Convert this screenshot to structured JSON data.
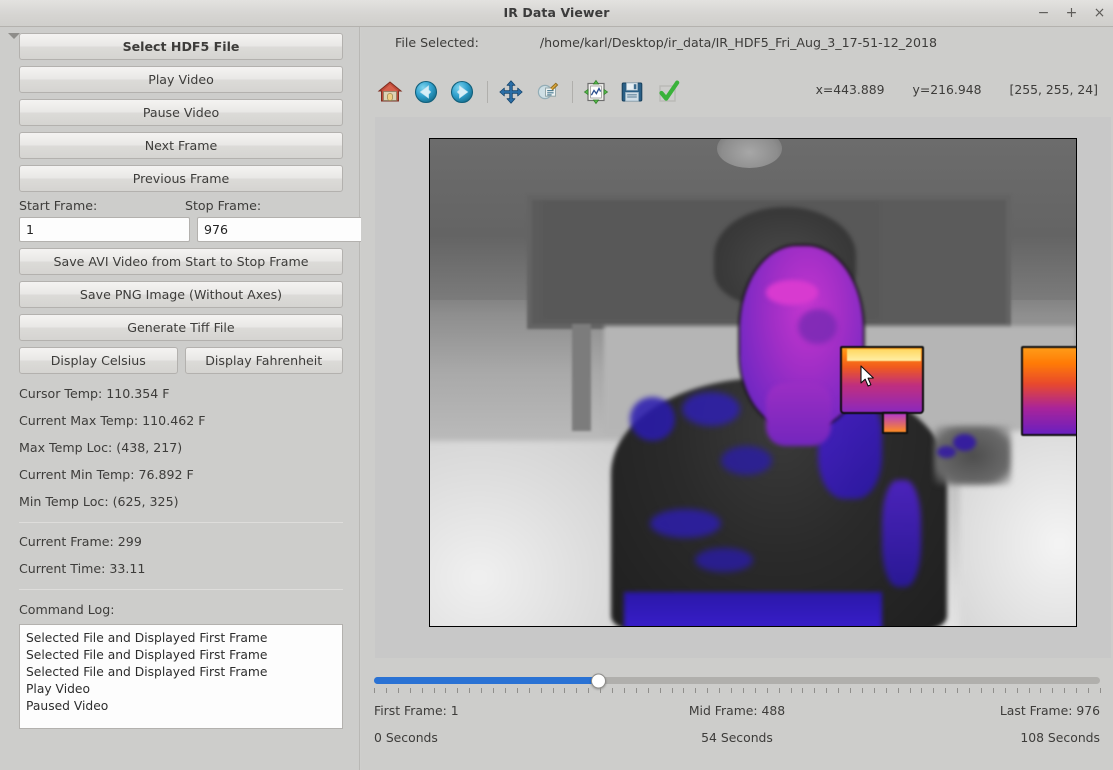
{
  "window": {
    "title": "IR Data Viewer",
    "minimize": "−",
    "maximize": "+",
    "close": "×"
  },
  "sidebar": {
    "buttons": [
      {
        "label": "Select HDF5 File",
        "bold": true
      },
      {
        "label": "Play Video",
        "bold": false
      },
      {
        "label": "Pause Video",
        "bold": false
      },
      {
        "label": "Next Frame",
        "bold": false
      },
      {
        "label": "Previous Frame",
        "bold": false
      }
    ],
    "start_frame_label": "Start Frame:",
    "stop_frame_label": "Stop Frame:",
    "start_frame_value": "1",
    "stop_frame_value": "976",
    "save_avi_label": "Save AVI Video from Start to Stop Frame",
    "save_png_label": "Save PNG Image (Without Axes)",
    "generate_tiff_label": "Generate Tiff File",
    "display_celsius_label": "Display Celsius",
    "display_fahrenheit_label": "Display Fahrenheit",
    "stats": [
      "Cursor Temp: 110.354 F",
      "Current Max Temp: 110.462 F",
      "Max Temp Loc: (438, 217)",
      "Current Min Temp: 76.892 F",
      "Min Temp Loc: (625, 325)"
    ],
    "frame_stats": [
      "Current Frame: 299",
      "Current Time: 33.11"
    ],
    "command_log_label": "Command Log:",
    "command_log": [
      "Selected File and Displayed First Frame",
      "Selected File and Displayed First Frame",
      "Selected File and Displayed First Frame",
      "Play Video",
      "Paused Video"
    ]
  },
  "main": {
    "file_selected_label": "File Selected:",
    "file_path": "/home/karl/Desktop/ir_data/IR_HDF5_Fri_Aug_3_17-51-12_2018",
    "toolbar": [
      {
        "name": "home-icon",
        "tip": "Home"
      },
      {
        "name": "back-arrow-icon",
        "tip": "Back"
      },
      {
        "name": "forward-arrow-icon",
        "tip": "Forward"
      },
      {
        "name": "pan-move-icon",
        "tip": "Pan"
      },
      {
        "name": "zoom-rect-icon",
        "tip": "Zoom to rectangle"
      },
      {
        "name": "configure-subplots-icon",
        "tip": "Configure subplots"
      },
      {
        "name": "save-floppy-icon",
        "tip": "Save figure"
      },
      {
        "name": "green-check-icon",
        "tip": "Apply"
      }
    ],
    "readout": {
      "x": "x=443.889",
      "y": "y=216.948",
      "rgb": "[255, 255, 24]"
    }
  },
  "chart_data": {
    "type": "heatmap",
    "title": "",
    "xlabel": "",
    "ylabel": "",
    "xticks": [
      0,
      100,
      200,
      300,
      400,
      500,
      600
    ],
    "yticks": [
      0,
      100,
      200,
      300,
      400
    ],
    "xlim": [
      0,
      640
    ],
    "ylim": [
      480,
      0
    ],
    "grid": false,
    "colormap": "gray + inferno overlay (thermal)",
    "description": "Infrared thermal camera frame showing a seated person; hot regions (face, arm) mapped to magenta/orange, background mapped to grayscale.",
    "annotations": {
      "max_temp_marker": [
        438,
        217
      ],
      "min_temp_marker": [
        625,
        325
      ],
      "cursor_position": [
        443.889,
        216.948
      ]
    }
  },
  "slider": {
    "value_percent": 31,
    "first_frame": "First Frame: 1",
    "mid_frame": "Mid Frame: 488",
    "last_frame": "Last Frame: 976",
    "first_seconds": "0 Seconds",
    "mid_seconds": "54 Seconds",
    "last_seconds": "108 Seconds"
  },
  "colors": {
    "panel": "#cdcdcb",
    "accent": "#2a72d4",
    "button_border": "#b3b1ae",
    "text": "#3d3c3a"
  }
}
